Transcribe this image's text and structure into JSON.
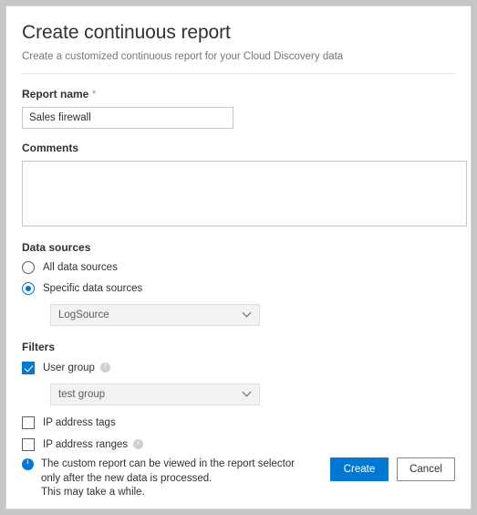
{
  "header": {
    "title": "Create continuous report",
    "subtitle": "Create a customized continuous report for your Cloud Discovery data"
  },
  "report_name": {
    "label": "Report name",
    "required_marker": "*",
    "value": "Sales firewall",
    "placeholder": ""
  },
  "comments": {
    "label": "Comments",
    "value": "",
    "placeholder": ""
  },
  "data_sources": {
    "section_label": "Data sources",
    "options": [
      {
        "label": "All data sources",
        "selected": false
      },
      {
        "label": "Specific data sources",
        "selected": true
      }
    ],
    "dropdown": {
      "value": "LogSource",
      "icon": "chevron-down-icon"
    }
  },
  "filters": {
    "section_label": "Filters",
    "items": [
      {
        "label": "User group",
        "checked": true,
        "info_icon": "info-icon"
      },
      {
        "label": "IP address tags",
        "checked": false,
        "info_icon": ""
      },
      {
        "label": "IP address ranges",
        "checked": false,
        "info_icon": "info-icon"
      }
    ],
    "user_group_dropdown": {
      "value": "test group",
      "icon": "chevron-down-icon"
    }
  },
  "footer": {
    "info_icon": "info-icon",
    "note_line_1": "The custom report can be viewed in the report selector only after the new data is processed.",
    "note_line_2": "This may take a while.",
    "create_label": "Create",
    "cancel_label": "Cancel"
  },
  "colors": {
    "accent": "#0078d4",
    "text": "#323130",
    "muted": "#797775",
    "border": "#c8c6c4",
    "page_background": "#c8c6c4",
    "field_background": "#f3f2f1"
  }
}
